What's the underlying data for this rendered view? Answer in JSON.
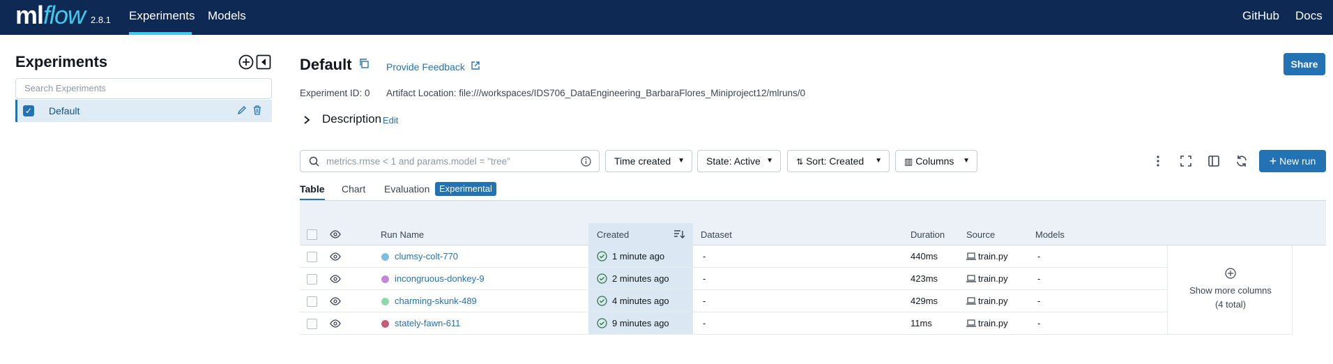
{
  "topbar": {
    "logo_ml": "ml",
    "logo_flow": "flow",
    "version": "2.8.1",
    "tabs": [
      {
        "label": "Experiments"
      },
      {
        "label": "Models"
      }
    ],
    "links": [
      {
        "label": "GitHub"
      },
      {
        "label": "Docs"
      }
    ]
  },
  "sidebar": {
    "title": "Experiments",
    "search_placeholder": "Search Experiments",
    "items": [
      {
        "label": "Default",
        "checked": true
      }
    ]
  },
  "experiment": {
    "name": "Default",
    "feedback": "Provide Feedback",
    "share": "Share",
    "id_text": "Experiment ID: 0",
    "artifact_text": "Artifact Location: file:///workspaces/IDS706_DataEngineering_BarbaraFlores_Miniproject12/mlruns/0",
    "description_label": "Description",
    "edit_label": "Edit"
  },
  "toolbar": {
    "search_placeholder": "metrics.rmse < 1 and params.model = \"tree\"",
    "time_created": "Time created",
    "state": "State: Active",
    "sort": "Sort: Created",
    "columns": "Columns",
    "new_run": "New run"
  },
  "view_tabs": [
    {
      "label": "Table"
    },
    {
      "label": "Chart"
    },
    {
      "label": "Evaluation"
    }
  ],
  "experimental_badge": "Experimental",
  "table": {
    "headers": {
      "run_name": "Run Name",
      "created": "Created",
      "dataset": "Dataset",
      "duration": "Duration",
      "source": "Source",
      "models": "Models"
    },
    "rows": [
      {
        "name": "clumsy-colt-770",
        "color": "#7fbde0",
        "created": "1 minute ago",
        "dataset": "-",
        "duration": "440ms",
        "source": "train.py",
        "models": "-"
      },
      {
        "name": "incongruous-donkey-9",
        "color": "#c389d6",
        "created": "2 minutes ago",
        "dataset": "-",
        "duration": "423ms",
        "source": "train.py",
        "models": "-"
      },
      {
        "name": "charming-skunk-489",
        "color": "#8fd8a8",
        "created": "4 minutes ago",
        "dataset": "-",
        "duration": "429ms",
        "source": "train.py",
        "models": "-"
      },
      {
        "name": "stately-fawn-611",
        "color": "#c75c75",
        "created": "9 minutes ago",
        "dataset": "-",
        "duration": "11ms",
        "source": "train.py",
        "models": "-"
      }
    ],
    "show_more": "Show more columns",
    "show_more_total": "(4 total)"
  }
}
